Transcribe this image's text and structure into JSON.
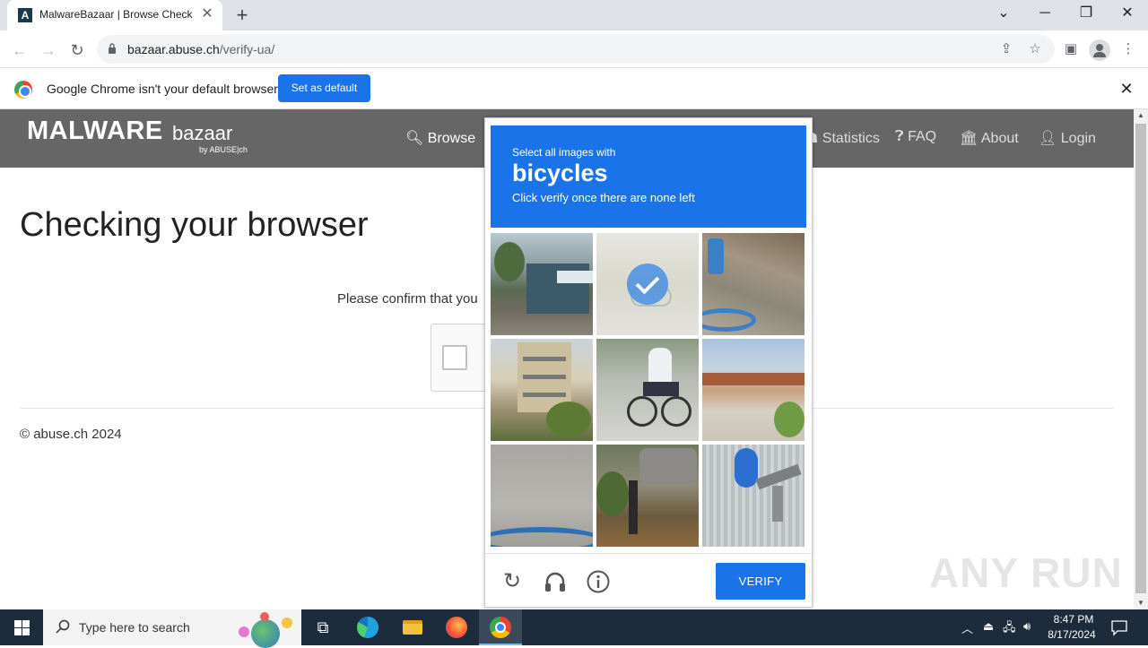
{
  "browser": {
    "tab_title": "MalwareBazaar | Browse Checking your browser",
    "tab_favicon_letter": "A",
    "url_host": "bazaar.abuse.ch",
    "url_path": "/verify-ua/",
    "icons": [
      "back-arrow-icon",
      "forward-arrow-icon",
      "reload-icon",
      "lock-icon",
      "share-icon",
      "star-icon",
      "sidebar-icon",
      "profile-icon",
      "menu-icon",
      "minimize-icon",
      "maximize-icon",
      "close-icon",
      "chevron-down-icon"
    ]
  },
  "infobar": {
    "message": "Google Chrome isn't your default browser",
    "button": "Set as default"
  },
  "site": {
    "logo_main": "MALWARE",
    "logo_sub": "bazaar",
    "logo_by": "by ABUSE|ch",
    "nav": {
      "browse": "Browse",
      "statistics": "Statistics",
      "faq": "FAQ",
      "about": "About",
      "login": "Login"
    },
    "title": "Checking your browser",
    "confirm_text": "Please confirm that you",
    "copyright": "© abuse.ch 2024"
  },
  "challenge": {
    "line1": "Select all images with",
    "target": "bicycles",
    "line3": "Click verify once there are none left",
    "verify_label": "VERIFY",
    "tiles_selected": [
      false,
      true,
      false,
      false,
      false,
      false,
      false,
      false,
      false
    ]
  },
  "watermark": "ANY RUN",
  "taskbar": {
    "search_placeholder": "Type here to search",
    "time": "8:47 PM",
    "date": "8/17/2024"
  },
  "colors": {
    "accent": "#1a73e8",
    "site_header": "#666666",
    "taskbar": "#1c2c3c"
  }
}
